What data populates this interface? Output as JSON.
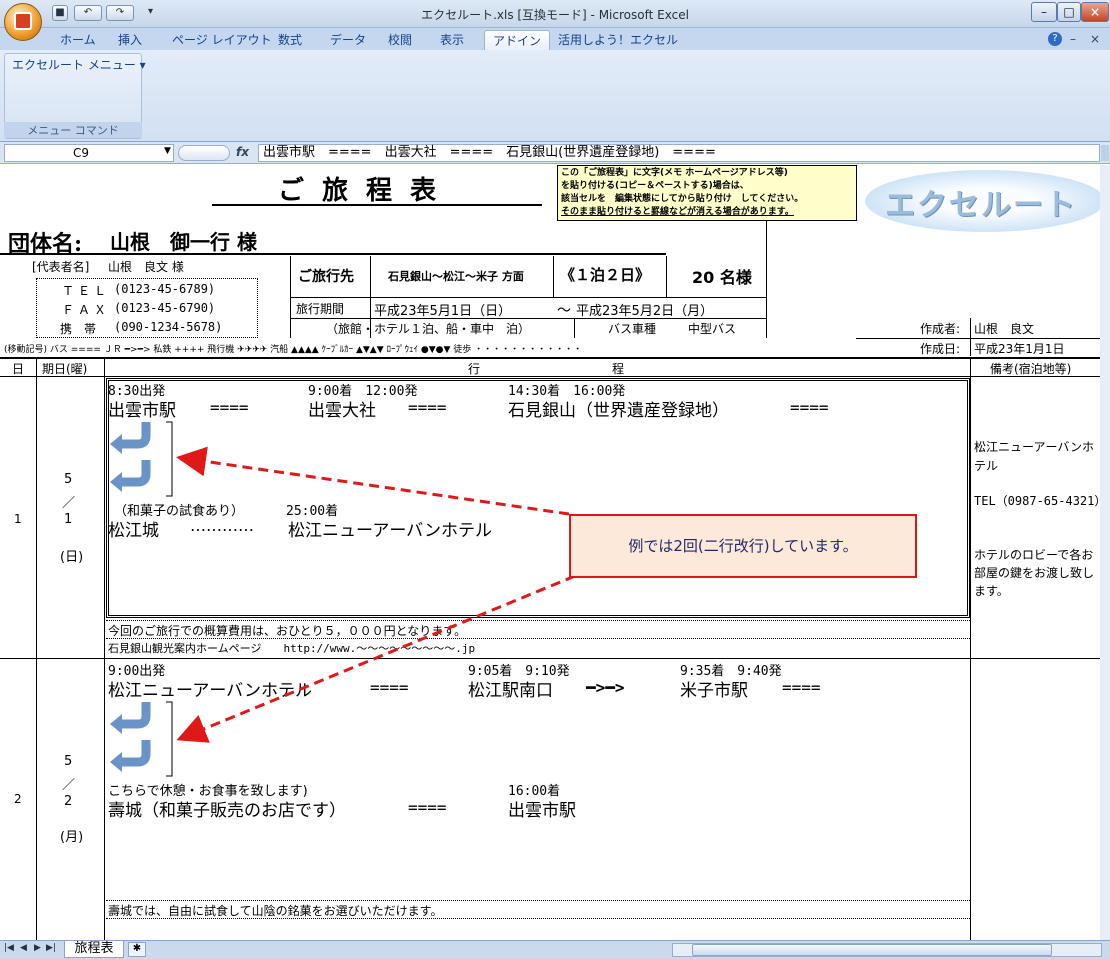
{
  "window": {
    "title": "エクセルート.xls [互換モード] - Microsoft Excel",
    "min": "–",
    "max": "□",
    "close": "×"
  },
  "qat": {
    "save": "■",
    "undo": "↶",
    "redo": "↷",
    "more": "▾"
  },
  "ribbon": {
    "tabs": [
      "ホーム",
      "挿入",
      "ページ レイアウト",
      "数式",
      "データ",
      "校閲",
      "表示",
      "アドイン",
      "活用しよう！エクセル"
    ],
    "active_tab": "アドイン",
    "menu_button": "エクセルート メニュー ▾",
    "group_label": "メニュー コマンド",
    "help": "?"
  },
  "formula_bar": {
    "cell": "C9",
    "fx": "fx",
    "content": "出雲市駅　====　出雲大社　====　石見銀山(世界遺産登録地)　===="
  },
  "sheet": {
    "title": "ご旅程表",
    "notice": [
      "この「ご旅程表」に文字(メモ ホームページアドレス等)",
      "を貼り付ける(コピー＆ペーストする)場合は、",
      "該当セルを　編集状態にしてから貼り付け　してください。",
      "そのまま貼り付けると罫線などが消える場合があります。"
    ],
    "logo": "エクセルート",
    "group_label": "団体名:",
    "group_name": "山根　御一行 様",
    "rep_label": "[代表者名]",
    "rep_name": "山根　良文 様",
    "tel_label": "ＴＥＬ",
    "tel": "(0123-45-6789)",
    "fax_label": "ＦＡＸ",
    "fax": "(0123-45-6790)",
    "mobile_label": "携　帯",
    "mobile": "(090-1234-5678)",
    "dest_label": "ご旅行先",
    "dest": "石見銀山～松江～米子 方面",
    "nights": "《１泊２日》",
    "people": "20 名様",
    "period_label": "旅行期間",
    "period_start": "平成23年5月1日（日）",
    "period_sep": "～",
    "period_end": "平成23年5月2日（月）",
    "lodging": "（旅館・ホテル１泊、船・車中　泊）",
    "bus_label": "バス車種",
    "bus": "中型バス",
    "author_label": "作成者:",
    "author": "山根　良文",
    "created_label": "作成日:",
    "created": "平成23年1月1日",
    "legend": "(移動記号)  バス ====   ＪＲ ━>━>   私鉄 ++++   飛行機 ✈✈✈✈   汽船 ▲▲▲▲   ｹｰﾌﾞﾙｶｰ ▲▼▲▼   ﾛｰﾌﾟｳｪｲ ●▼●▼   徒歩 ・・・・・・・・・・・・",
    "headers": {
      "day": "日",
      "date": "期日(曜)",
      "itinerary": "行　　　　　　　　　　　程",
      "notes": "備考(宿泊地等)"
    },
    "days": [
      {
        "num": "1",
        "month": "5",
        "slash": "／",
        "day": "1",
        "dow": "(日)",
        "times1": [
          "8:30出発",
          "9:00着　12:00発",
          "14:30着　16:00発"
        ],
        "route1": [
          "出雲市駅",
          "====",
          "出雲大社",
          "====",
          "石見銀山（世界遺産登録地）",
          "===="
        ],
        "note_line": "（和菓子の試食あり）",
        "time_late": "25:00着",
        "route2": [
          "松江城",
          "…………",
          "松江ニューアーバンホテル"
        ],
        "footer1": "今回のご旅行での概算費用は、おひとり５，０００円となります。",
        "footer2": "石見銀山観光案内ホームページ　　http://www.～～～～～～～～～.jp",
        "notes": [
          "松江ニューアーバンホテル",
          "TEL（0987-65-4321）",
          "ホテルのロビーで各お部屋の鍵をお渡し致します。"
        ]
      },
      {
        "num": "2",
        "month": "5",
        "slash": "／",
        "day": "2",
        "dow": "(月)",
        "times1": [
          "9:00出発",
          "9:05着　9:10発",
          "9:35着　9:40発"
        ],
        "route1": [
          "松江ニューアーバンホテル",
          "====",
          "松江駅南口",
          "━>━>",
          "米子市駅",
          "===="
        ],
        "note_line": "こちらで休憩・お食事を致します)",
        "time_late": "16:00着",
        "route2": [
          "壽城（和菓子販売のお店です）",
          "====",
          "出雲市駅"
        ],
        "footer1": "壽城では、自由に試食して山陰の銘菓をお選びいただけます。"
      }
    ],
    "callout": "例では2回(二行改行)しています。",
    "sheet_tab": "旅程表"
  }
}
